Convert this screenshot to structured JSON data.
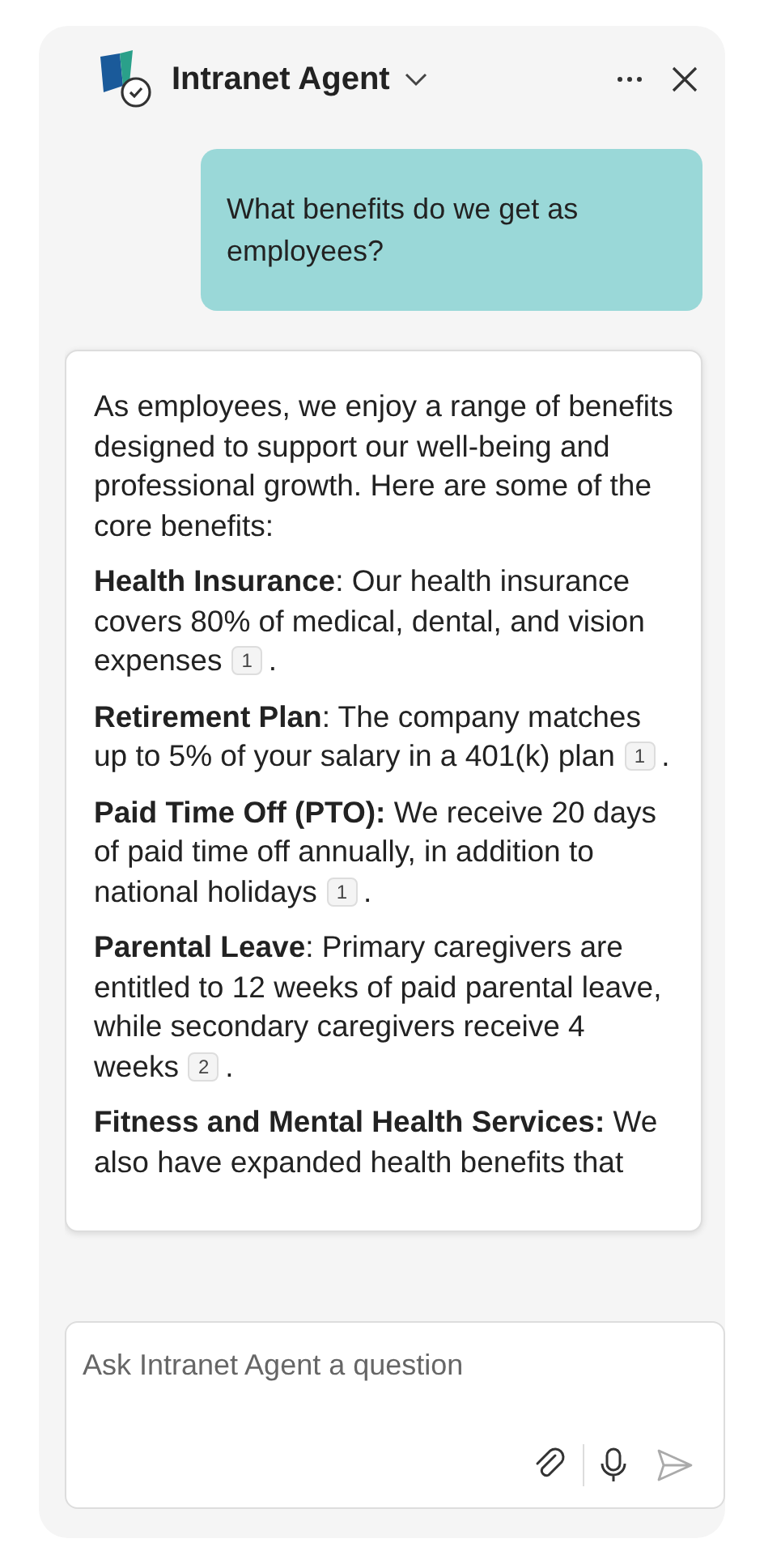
{
  "header": {
    "title": "Intranet Agent"
  },
  "messages": [
    {
      "kind": "user",
      "text": "What benefits do we get as employees?"
    },
    {
      "kind": "agent",
      "intro": "As employees, we enjoy a range of benefits designed to support our well-being and professional growth. Here are some of the core benefits:",
      "items": [
        {
          "title": "Health Insurance",
          "text": ": Our health insurance covers 80% of medical, dental, and vision expenses",
          "citation": "1",
          "end": "."
        },
        {
          "title": "Retirement Plan",
          "text": ": The company matches up to 5% of your salary in a 401(k) plan",
          "citation": "1",
          "end": "."
        },
        {
          "title": "Paid Time Off (PTO):",
          "text": " We receive 20 days of paid time off annually, in addition to national holidays",
          "citation": "1",
          "end": "."
        },
        {
          "title": "Parental Leave",
          "text": ": Primary caregivers are entitled to 12 weeks of paid parental leave, while secondary caregivers receive 4 weeks",
          "citation": "2",
          "end": "."
        },
        {
          "title": "Fitness and Mental Health Services:",
          "text": " We also have expanded health benefits that"
        }
      ]
    }
  ],
  "composer": {
    "placeholder": "Ask Intranet Agent a question",
    "send_disabled": true
  }
}
